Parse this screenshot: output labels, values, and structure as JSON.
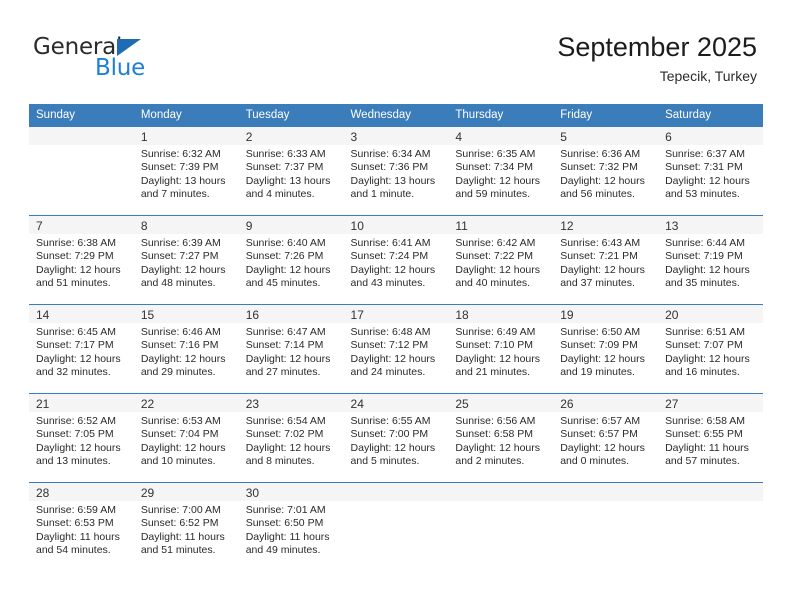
{
  "brand": {
    "name_top": "General",
    "name_bottom": "Blue",
    "triangle_color": "#1f6cb5",
    "blue_color": "#1f7fd4"
  },
  "header": {
    "title": "September 2025",
    "subtitle": "Tepecik, Turkey"
  },
  "theme": {
    "header_bg": "#3b7cba",
    "header_text": "#ffffff",
    "daynum_strip": "#f5f5f5",
    "row_rule": "#3b7cba"
  },
  "weekday_headers": [
    "Sunday",
    "Monday",
    "Tuesday",
    "Wednesday",
    "Thursday",
    "Friday",
    "Saturday"
  ],
  "weeks": [
    [
      {
        "day": "",
        "lines": []
      },
      {
        "day": "1",
        "lines": [
          "Sunrise: 6:32 AM",
          "Sunset: 7:39 PM",
          "Daylight: 13 hours",
          "and 7 minutes."
        ]
      },
      {
        "day": "2",
        "lines": [
          "Sunrise: 6:33 AM",
          "Sunset: 7:37 PM",
          "Daylight: 13 hours",
          "and 4 minutes."
        ]
      },
      {
        "day": "3",
        "lines": [
          "Sunrise: 6:34 AM",
          "Sunset: 7:36 PM",
          "Daylight: 13 hours",
          "and 1 minute."
        ]
      },
      {
        "day": "4",
        "lines": [
          "Sunrise: 6:35 AM",
          "Sunset: 7:34 PM",
          "Daylight: 12 hours",
          "and 59 minutes."
        ]
      },
      {
        "day": "5",
        "lines": [
          "Sunrise: 6:36 AM",
          "Sunset: 7:32 PM",
          "Daylight: 12 hours",
          "and 56 minutes."
        ]
      },
      {
        "day": "6",
        "lines": [
          "Sunrise: 6:37 AM",
          "Sunset: 7:31 PM",
          "Daylight: 12 hours",
          "and 53 minutes."
        ]
      }
    ],
    [
      {
        "day": "7",
        "lines": [
          "Sunrise: 6:38 AM",
          "Sunset: 7:29 PM",
          "Daylight: 12 hours",
          "and 51 minutes."
        ]
      },
      {
        "day": "8",
        "lines": [
          "Sunrise: 6:39 AM",
          "Sunset: 7:27 PM",
          "Daylight: 12 hours",
          "and 48 minutes."
        ]
      },
      {
        "day": "9",
        "lines": [
          "Sunrise: 6:40 AM",
          "Sunset: 7:26 PM",
          "Daylight: 12 hours",
          "and 45 minutes."
        ]
      },
      {
        "day": "10",
        "lines": [
          "Sunrise: 6:41 AM",
          "Sunset: 7:24 PM",
          "Daylight: 12 hours",
          "and 43 minutes."
        ]
      },
      {
        "day": "11",
        "lines": [
          "Sunrise: 6:42 AM",
          "Sunset: 7:22 PM",
          "Daylight: 12 hours",
          "and 40 minutes."
        ]
      },
      {
        "day": "12",
        "lines": [
          "Sunrise: 6:43 AM",
          "Sunset: 7:21 PM",
          "Daylight: 12 hours",
          "and 37 minutes."
        ]
      },
      {
        "day": "13",
        "lines": [
          "Sunrise: 6:44 AM",
          "Sunset: 7:19 PM",
          "Daylight: 12 hours",
          "and 35 minutes."
        ]
      }
    ],
    [
      {
        "day": "14",
        "lines": [
          "Sunrise: 6:45 AM",
          "Sunset: 7:17 PM",
          "Daylight: 12 hours",
          "and 32 minutes."
        ]
      },
      {
        "day": "15",
        "lines": [
          "Sunrise: 6:46 AM",
          "Sunset: 7:16 PM",
          "Daylight: 12 hours",
          "and 29 minutes."
        ]
      },
      {
        "day": "16",
        "lines": [
          "Sunrise: 6:47 AM",
          "Sunset: 7:14 PM",
          "Daylight: 12 hours",
          "and 27 minutes."
        ]
      },
      {
        "day": "17",
        "lines": [
          "Sunrise: 6:48 AM",
          "Sunset: 7:12 PM",
          "Daylight: 12 hours",
          "and 24 minutes."
        ]
      },
      {
        "day": "18",
        "lines": [
          "Sunrise: 6:49 AM",
          "Sunset: 7:10 PM",
          "Daylight: 12 hours",
          "and 21 minutes."
        ]
      },
      {
        "day": "19",
        "lines": [
          "Sunrise: 6:50 AM",
          "Sunset: 7:09 PM",
          "Daylight: 12 hours",
          "and 19 minutes."
        ]
      },
      {
        "day": "20",
        "lines": [
          "Sunrise: 6:51 AM",
          "Sunset: 7:07 PM",
          "Daylight: 12 hours",
          "and 16 minutes."
        ]
      }
    ],
    [
      {
        "day": "21",
        "lines": [
          "Sunrise: 6:52 AM",
          "Sunset: 7:05 PM",
          "Daylight: 12 hours",
          "and 13 minutes."
        ]
      },
      {
        "day": "22",
        "lines": [
          "Sunrise: 6:53 AM",
          "Sunset: 7:04 PM",
          "Daylight: 12 hours",
          "and 10 minutes."
        ]
      },
      {
        "day": "23",
        "lines": [
          "Sunrise: 6:54 AM",
          "Sunset: 7:02 PM",
          "Daylight: 12 hours",
          "and 8 minutes."
        ]
      },
      {
        "day": "24",
        "lines": [
          "Sunrise: 6:55 AM",
          "Sunset: 7:00 PM",
          "Daylight: 12 hours",
          "and 5 minutes."
        ]
      },
      {
        "day": "25",
        "lines": [
          "Sunrise: 6:56 AM",
          "Sunset: 6:58 PM",
          "Daylight: 12 hours",
          "and 2 minutes."
        ]
      },
      {
        "day": "26",
        "lines": [
          "Sunrise: 6:57 AM",
          "Sunset: 6:57 PM",
          "Daylight: 12 hours",
          "and 0 minutes."
        ]
      },
      {
        "day": "27",
        "lines": [
          "Sunrise: 6:58 AM",
          "Sunset: 6:55 PM",
          "Daylight: 11 hours",
          "and 57 minutes."
        ]
      }
    ],
    [
      {
        "day": "28",
        "lines": [
          "Sunrise: 6:59 AM",
          "Sunset: 6:53 PM",
          "Daylight: 11 hours",
          "and 54 minutes."
        ]
      },
      {
        "day": "29",
        "lines": [
          "Sunrise: 7:00 AM",
          "Sunset: 6:52 PM",
          "Daylight: 11 hours",
          "and 51 minutes."
        ]
      },
      {
        "day": "30",
        "lines": [
          "Sunrise: 7:01 AM",
          "Sunset: 6:50 PM",
          "Daylight: 11 hours",
          "and 49 minutes."
        ]
      },
      {
        "day": "",
        "lines": []
      },
      {
        "day": "",
        "lines": []
      },
      {
        "day": "",
        "lines": []
      },
      {
        "day": "",
        "lines": []
      }
    ]
  ]
}
